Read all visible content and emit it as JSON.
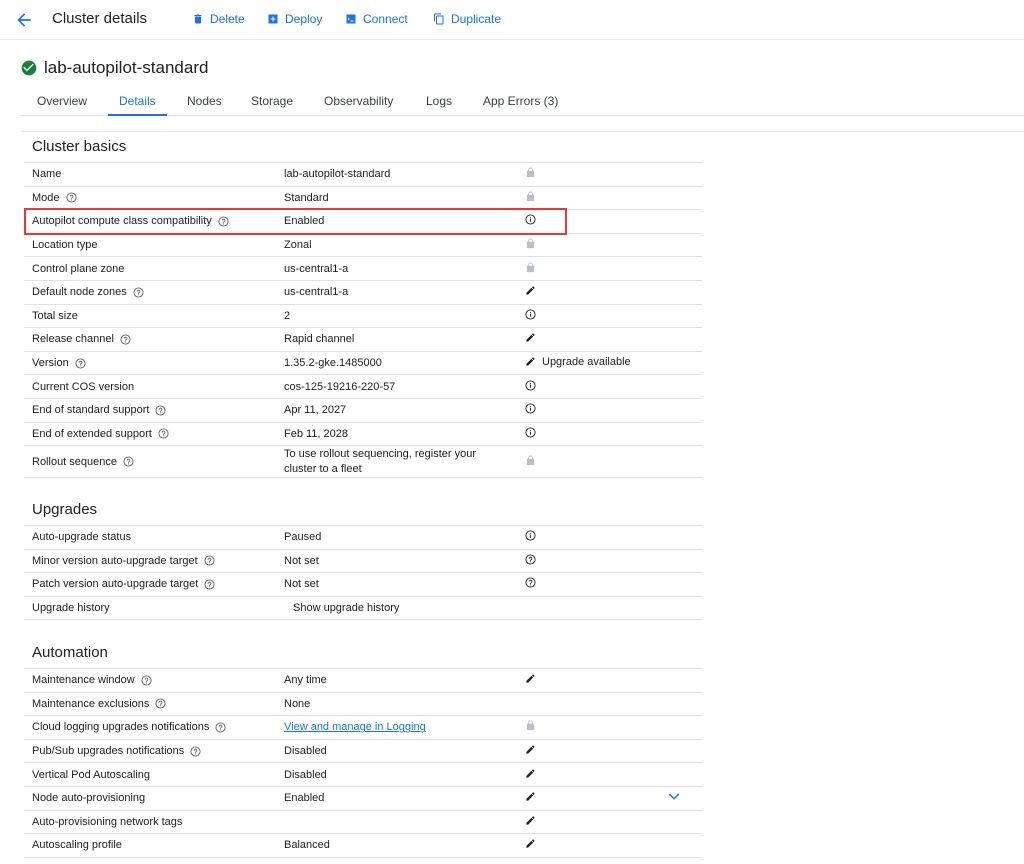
{
  "header": {
    "title": "Cluster details",
    "actions": [
      {
        "label": "Delete",
        "icon": "trash-icon"
      },
      {
        "label": "Deploy",
        "icon": "deploy-icon"
      },
      {
        "label": "Connect",
        "icon": "terminal-icon"
      },
      {
        "label": "Duplicate",
        "icon": "copy-icon"
      }
    ]
  },
  "cluster": {
    "name": "lab-autopilot-standard",
    "status_icon": "check-circle-icon",
    "status_color": "#188038"
  },
  "tabs": [
    "Overview",
    "Details",
    "Nodes",
    "Storage",
    "Observability",
    "Logs",
    "App Errors (3)"
  ],
  "active_tab": "Details",
  "sections": {
    "basics": {
      "title": "Cluster basics",
      "rows": [
        {
          "label": "Name",
          "value": "lab-autopilot-standard",
          "icon": "lock-icon"
        },
        {
          "label": "Mode",
          "value": "Standard",
          "icon": "lock-icon",
          "help": true
        },
        {
          "label": "Autopilot compute class compatibility",
          "value": "Enabled",
          "icon": "info-icon",
          "help": true
        },
        {
          "label": "Location type",
          "value": "Zonal",
          "icon": "lock-icon"
        },
        {
          "label": "Control plane zone",
          "value": "us-central1-a",
          "icon": "lock-icon"
        },
        {
          "label": "Default node zones",
          "value": "us-central1-a",
          "icon": "edit-icon",
          "help": true
        },
        {
          "label": "Total size",
          "value": "2",
          "icon": "info-icon"
        },
        {
          "label": "Release channel",
          "value": "Rapid channel",
          "icon": "edit-icon",
          "help": true
        },
        {
          "label": "Version",
          "value": "1.35.2-gke.1485000",
          "icon": "edit-icon",
          "icon_text": "Upgrade available",
          "help": true
        },
        {
          "label": "Current COS version",
          "value": "cos-125-19216-220-57",
          "icon": "info-icon"
        },
        {
          "label": "End of standard support",
          "value": "Apr 11, 2027",
          "icon": "info-icon",
          "help": true
        },
        {
          "label": "End of extended support",
          "value": "Feb 11, 2028",
          "icon": "info-icon",
          "help": true
        },
        {
          "label": "Rollout sequence",
          "value_line1": "To use rollout sequencing, register your",
          "value_line2": "cluster to a fleet",
          "icon": "lock-icon",
          "help": true
        }
      ]
    },
    "upgrades": {
      "title": "Upgrades",
      "rows": [
        {
          "label": "Auto-upgrade status",
          "value": "Paused",
          "icon": "info-icon"
        },
        {
          "label": "Minor version auto-upgrade target",
          "value": "Not set",
          "icon": "help-icon",
          "help": true
        },
        {
          "label": "Patch version auto-upgrade target",
          "value": "Not set",
          "icon": "help-icon",
          "help": true
        },
        {
          "label": "Upgrade history",
          "button": "Show upgrade history"
        }
      ]
    },
    "automation": {
      "title": "Automation",
      "rows": [
        {
          "label": "Maintenance window",
          "value": "Any time",
          "icon": "edit-icon",
          "help": true
        },
        {
          "label": "Maintenance exclusions",
          "value": "None",
          "help": true
        },
        {
          "label": "Cloud logging upgrades notifications",
          "link": "View and manage in Logging",
          "icon": "lock-icon",
          "help": true
        },
        {
          "label": "Pub/Sub upgrades notifications",
          "value": "Disabled",
          "icon": "edit-icon",
          "help": true
        },
        {
          "label": "Vertical Pod Autoscaling",
          "value": "Disabled",
          "icon": "edit-icon"
        },
        {
          "label": "Node auto-provisioning",
          "value": "Enabled",
          "icon": "edit-icon",
          "expand_icon": "chevron-down-icon"
        },
        {
          "label": "Auto-provisioning network tags",
          "value": "",
          "icon": "edit-icon"
        },
        {
          "label": "Autoscaling profile",
          "value": "Balanced",
          "icon": "edit-icon"
        }
      ]
    }
  },
  "colors": {
    "accent": "#1a73e8",
    "highlight": "#e53935",
    "lock": "#9aa0a6"
  }
}
